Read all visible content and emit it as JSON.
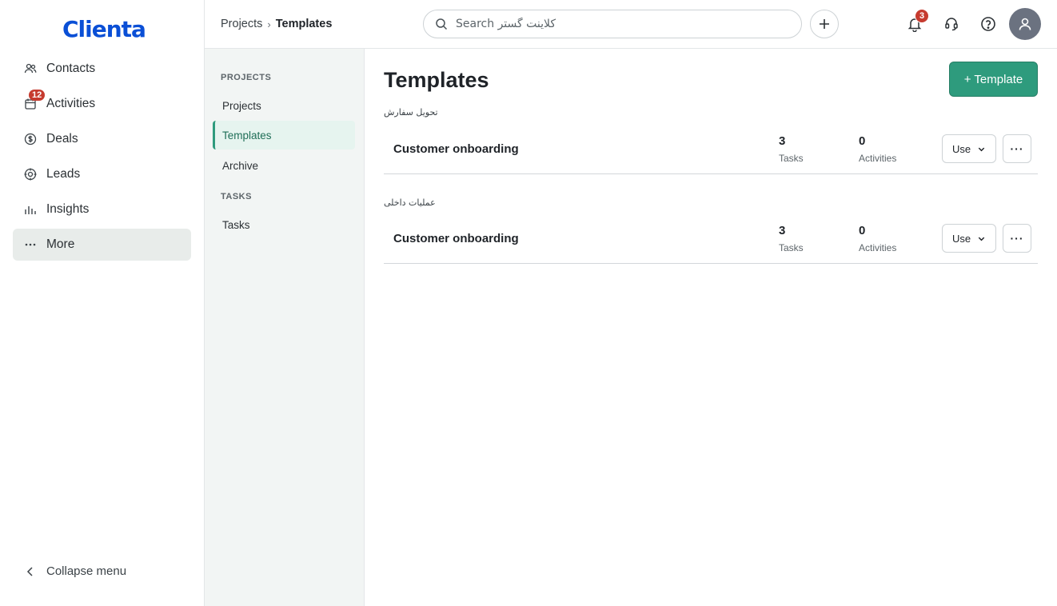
{
  "app": {
    "logo_text": "Clienta"
  },
  "sidebar": {
    "items": [
      {
        "label": "Contacts",
        "icon": "contacts-icon"
      },
      {
        "label": "Activities",
        "icon": "calendar-icon",
        "badge": "12"
      },
      {
        "label": "Deals",
        "icon": "dollar-icon"
      },
      {
        "label": "Leads",
        "icon": "target-icon"
      },
      {
        "label": "Insights",
        "icon": "bar-chart-icon"
      },
      {
        "label": "More",
        "icon": "more-icon"
      }
    ],
    "collapse_label": "Collapse menu"
  },
  "header": {
    "breadcrumb": [
      "Projects",
      "Templates"
    ],
    "search_placeholder": "Search کلاینت گستر",
    "notification_count": "3"
  },
  "subnav": {
    "sections": [
      {
        "title": "PROJECTS",
        "links": [
          "Projects",
          "Templates",
          "Archive"
        ]
      },
      {
        "title": "TASKS",
        "links": [
          "Tasks"
        ]
      }
    ],
    "active": "Templates"
  },
  "main": {
    "title": "Templates",
    "add_button": "+ Template",
    "groups": [
      {
        "label": "تحویل سفارش",
        "rows": [
          {
            "name": "Customer onboarding",
            "tasks": "3",
            "tasks_label": "Tasks",
            "activities": "0",
            "activities_label": "Activities",
            "use_label": "Use",
            "more_label": "···"
          }
        ]
      },
      {
        "label": "عملیات داخلی",
        "rows": [
          {
            "name": "Customer onboarding",
            "tasks": "3",
            "tasks_label": "Tasks",
            "activities": "0",
            "activities_label": "Activities",
            "use_label": "Use",
            "more_label": "···"
          }
        ]
      }
    ]
  },
  "colors": {
    "accent": "#2e9b7d",
    "badge": "#c63b2f",
    "brand": "#0a4fd6"
  }
}
